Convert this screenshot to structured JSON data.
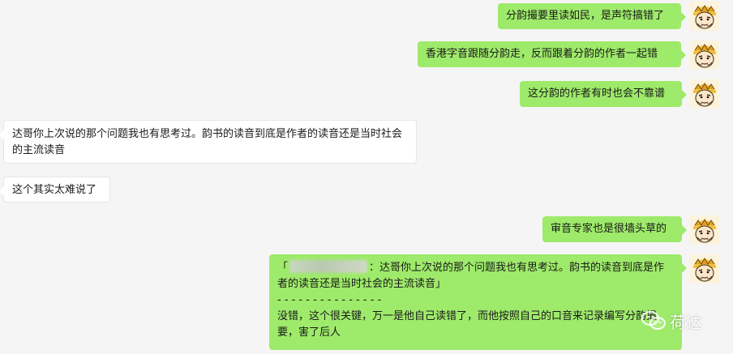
{
  "messages": [
    {
      "side": "out",
      "text": "分韵撮要里读如民，是声符搞错了"
    },
    {
      "side": "out",
      "text": "香港字音跟随分韵走，反而跟着分韵的作者一起错"
    },
    {
      "side": "out",
      "text": "这分韵的作者有时也会不靠谱"
    },
    {
      "side": "in",
      "text": "达哥你上次说的那个问题我也有思考过。韵书的读音到底是作者的读音还是当时社会的主流读音"
    },
    {
      "side": "in",
      "text": "这个其实太难说了"
    },
    {
      "side": "out",
      "text": "审音专家也是很墙头草的"
    },
    {
      "side": "out",
      "quote_open": "「",
      "quote_text": "：达哥你上次说的那个问题我也有思考过。韵书的读音到底是作者的读音还是当时社会的主流读音」",
      "separator": "- - - - - - - - - - - - - - -",
      "reply_text": "没错，这个很关键，万一是他自己读错了，而他按照自己的口音来记录编写分韵撮要，害了后人"
    }
  ],
  "watermark": {
    "text": "荷达",
    "icon": "wechat-icon"
  },
  "colors": {
    "background": "#f5f5f5",
    "outgoing_bubble": "#9eea6a",
    "incoming_bubble": "#ffffff"
  }
}
